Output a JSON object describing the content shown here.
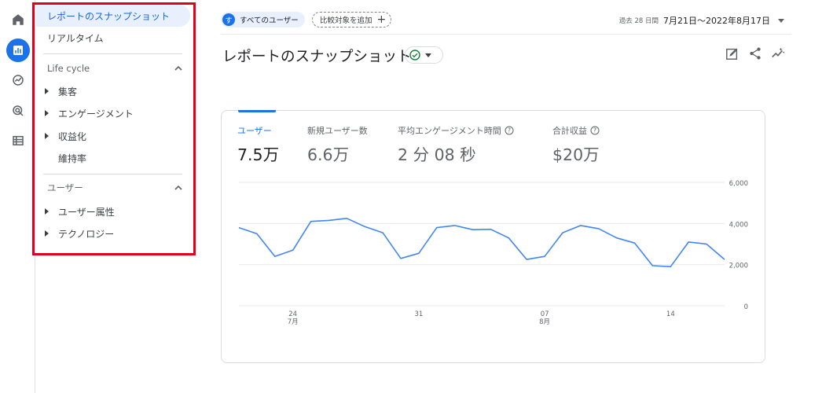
{
  "rail": {
    "items": [
      {
        "name": "home-icon"
      },
      {
        "name": "reports-icon",
        "active": true
      },
      {
        "name": "explore-icon"
      },
      {
        "name": "advertising-icon"
      },
      {
        "name": "configure-icon"
      }
    ]
  },
  "sidebar": {
    "snapshot_label": "レポートのスナップショット",
    "realtime_label": "リアルタイム",
    "lifecycle_header": "Life cycle",
    "lifecycle_items": [
      "集客",
      "エンゲージメント",
      "収益化",
      "維持率"
    ],
    "user_header": "ユーザー",
    "user_items": [
      "ユーザー属性",
      "テクノロジー"
    ]
  },
  "topbar": {
    "avatar_letter": "す",
    "user_chip_label": "すべてのユーザー",
    "compare_chip_label": "比較対象を追加",
    "date_prefix": "過去 28 日間",
    "date_range": "7月21日〜2022年8月17日"
  },
  "header": {
    "title": "レポートのスナップショット",
    "status_color": "#188038"
  },
  "metrics": [
    {
      "label": "ユーザー",
      "value": "7.5万",
      "active": true,
      "help": false
    },
    {
      "label": "新規ユーザー数",
      "value": "6.6万",
      "active": false,
      "help": false
    },
    {
      "label": "平均エンゲージメント時間",
      "value": "2 分 08 秒",
      "active": false,
      "help": true
    },
    {
      "label": "合計収益",
      "value": "$20万",
      "active": false,
      "help": true
    }
  ],
  "colors": {
    "accent": "#1a73e8",
    "highlight_frame": "#e0001b",
    "line": "#4285f4"
  },
  "chart_data": {
    "type": "line",
    "x": [
      "2022-07-21",
      "2022-07-22",
      "2022-07-23",
      "2022-07-24",
      "2022-07-25",
      "2022-07-26",
      "2022-07-27",
      "2022-07-28",
      "2022-07-29",
      "2022-07-30",
      "2022-07-31",
      "2022-08-01",
      "2022-08-02",
      "2022-08-03",
      "2022-08-04",
      "2022-08-05",
      "2022-08-06",
      "2022-08-07",
      "2022-08-08",
      "2022-08-09",
      "2022-08-10",
      "2022-08-11",
      "2022-08-12",
      "2022-08-13",
      "2022-08-14",
      "2022-08-15",
      "2022-08-16",
      "2022-08-17"
    ],
    "series": [
      {
        "values": [
          3800,
          3500,
          2400,
          2700,
          4100,
          4150,
          4250,
          3850,
          3550,
          2300,
          2550,
          3800,
          3900,
          3700,
          3720,
          3300,
          2250,
          2400,
          3550,
          3900,
          3750,
          3300,
          3050,
          1950,
          1900,
          3100,
          3000,
          2250
        ]
      }
    ],
    "x_ticks": [
      {
        "date": "2022-07-24",
        "day": "24",
        "month": "7月"
      },
      {
        "date": "2022-07-31",
        "day": "31",
        "month": ""
      },
      {
        "date": "2022-08-07",
        "day": "07",
        "month": "8月"
      },
      {
        "date": "2022-08-14",
        "day": "14",
        "month": ""
      }
    ],
    "y_ticks": [
      "6,000",
      "4,000",
      "2,000",
      "0"
    ],
    "ylim": [
      0,
      6000
    ],
    "grid": true
  }
}
